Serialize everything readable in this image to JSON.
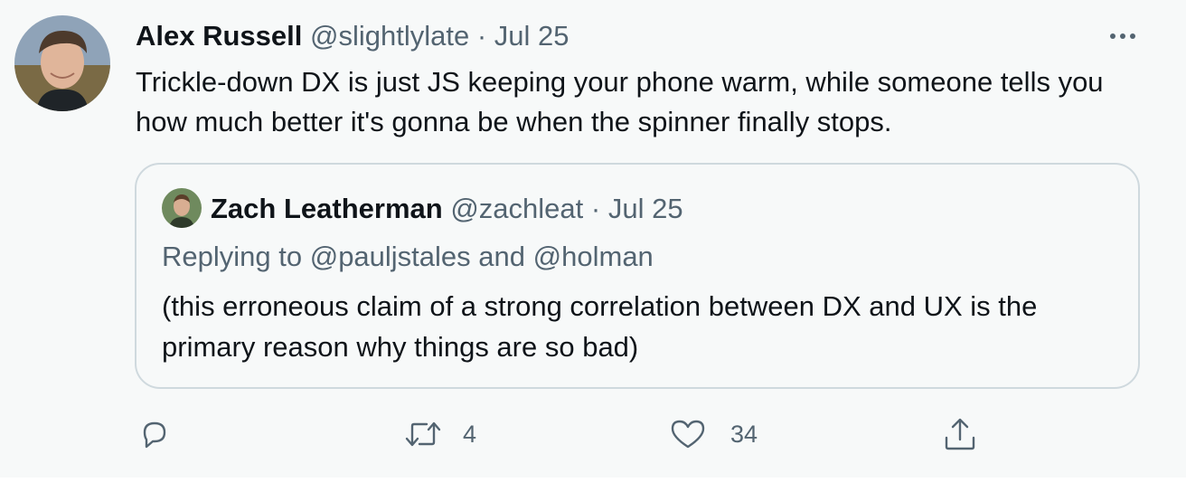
{
  "tweet": {
    "author_name": "Alex Russell",
    "handle": "@slightlylate",
    "separator": "·",
    "date": "Jul 25",
    "text": "Trickle-down DX is just JS keeping your phone warm, while someone tells you how much better it's gonna be when the spinner finally stops."
  },
  "quote": {
    "author_name": "Zach Leatherman",
    "handle": "@zachleat",
    "separator": "·",
    "date": "Jul 25",
    "replying_to_prefix": "Replying to",
    "replying_user_1": "@pauljstales",
    "replying_and": "and",
    "replying_user_2": "@holman",
    "text": "(this erroneous claim of a strong correlation between DX and UX is the primary reason why things are so bad)"
  },
  "actions": {
    "retweet_count": "4",
    "like_count": "34"
  },
  "icons": {
    "more": "more-icon",
    "reply": "reply-icon",
    "retweet": "retweet-icon",
    "like": "like-icon",
    "share": "share-icon"
  },
  "colors": {
    "background": "#f7f9f9",
    "text": "#0f1419",
    "muted": "#536471",
    "border": "#cfd9de"
  }
}
